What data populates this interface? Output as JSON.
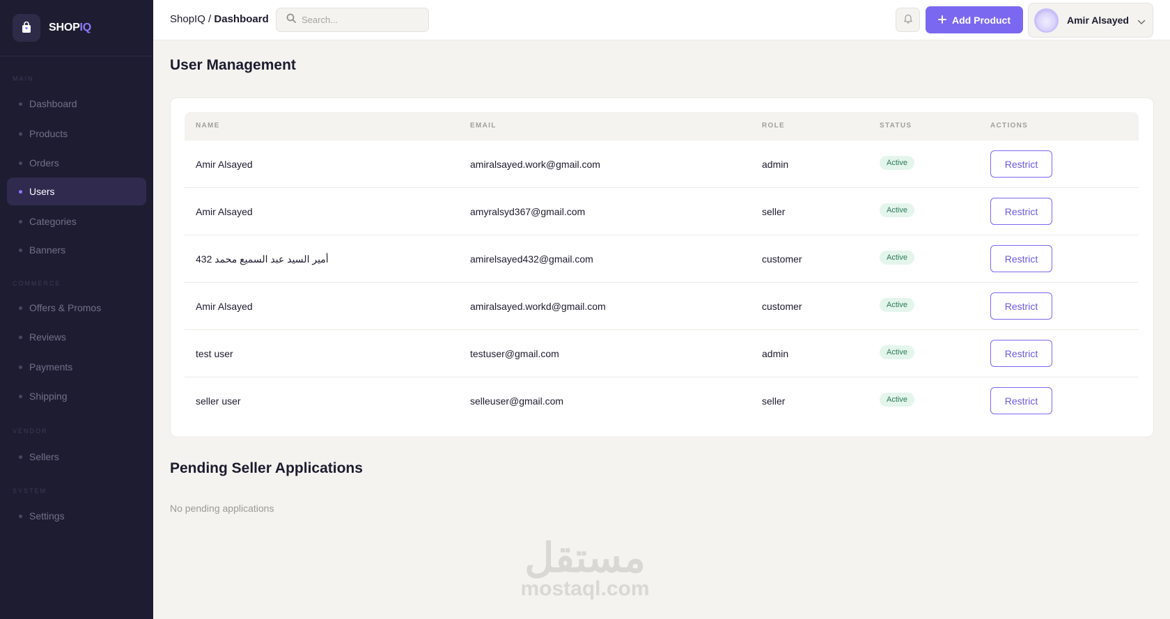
{
  "brand": {
    "name_main": "SHOP",
    "name_accent": "IQ"
  },
  "sidebar": {
    "sections": [
      {
        "title": "MAIN"
      },
      {
        "title": "COMMERCE"
      },
      {
        "title": "VENDOR"
      },
      {
        "title": "SYSTEM"
      }
    ],
    "items": [
      {
        "label": "Dashboard"
      },
      {
        "label": "Products"
      },
      {
        "label": "Orders"
      },
      {
        "label": "Users",
        "active": true
      },
      {
        "label": "Categories"
      },
      {
        "label": "Banners"
      },
      {
        "label": "Offers & Promos"
      },
      {
        "label": "Reviews"
      },
      {
        "label": "Payments"
      },
      {
        "label": "Shipping"
      },
      {
        "label": "Sellers"
      },
      {
        "label": "Settings"
      }
    ]
  },
  "header": {
    "breadcrumb_root": "ShopIQ",
    "breadcrumb_sep": "/",
    "breadcrumb_current": "Dashboard",
    "search_placeholder": "Search...",
    "add_button": "Add Product",
    "user_name": "Amir Alsayed"
  },
  "users_section": {
    "title": "User Management",
    "columns": [
      "NAME",
      "EMAIL",
      "ROLE",
      "STATUS",
      "ACTIONS"
    ],
    "rows": [
      {
        "name": "Amir Alsayed",
        "email": "amiralsayed.work@gmail.com",
        "role": "admin",
        "status": "Active",
        "action": "Restrict"
      },
      {
        "name": "Amir Alsayed",
        "email": "amyralsyd367@gmail.com",
        "role": "seller",
        "status": "Active",
        "action": "Restrict"
      },
      {
        "name": "أمير السيد عبد السميع محمد 432",
        "email": "amirelsayed432@gmail.com",
        "role": "customer",
        "status": "Active",
        "action": "Restrict"
      },
      {
        "name": "Amir Alsayed",
        "email": "amiralsayed.workd@gmail.com",
        "role": "customer",
        "status": "Active",
        "action": "Restrict"
      },
      {
        "name": "test user",
        "email": "testuser@gmail.com",
        "role": "admin",
        "status": "Active",
        "action": "Restrict"
      },
      {
        "name": "seller user",
        "email": "selleuser@gmail.com",
        "role": "seller",
        "status": "Active",
        "action": "Restrict"
      }
    ]
  },
  "pending_section": {
    "title": "Pending Seller Applications",
    "empty_text": "No pending applications"
  },
  "watermark": {
    "arabic": "مستقل",
    "latin": "mostaql.com"
  },
  "colors": {
    "sidebar_bg": "#1e1c31",
    "accent": "#7b68f0",
    "status_active_bg": "#e4f5ec",
    "status_active_fg": "#2a7a55"
  },
  "icons": [
    "brand-logo-icon",
    "search-icon",
    "bell-icon",
    "plus-icon",
    "chevron-down-icon"
  ]
}
